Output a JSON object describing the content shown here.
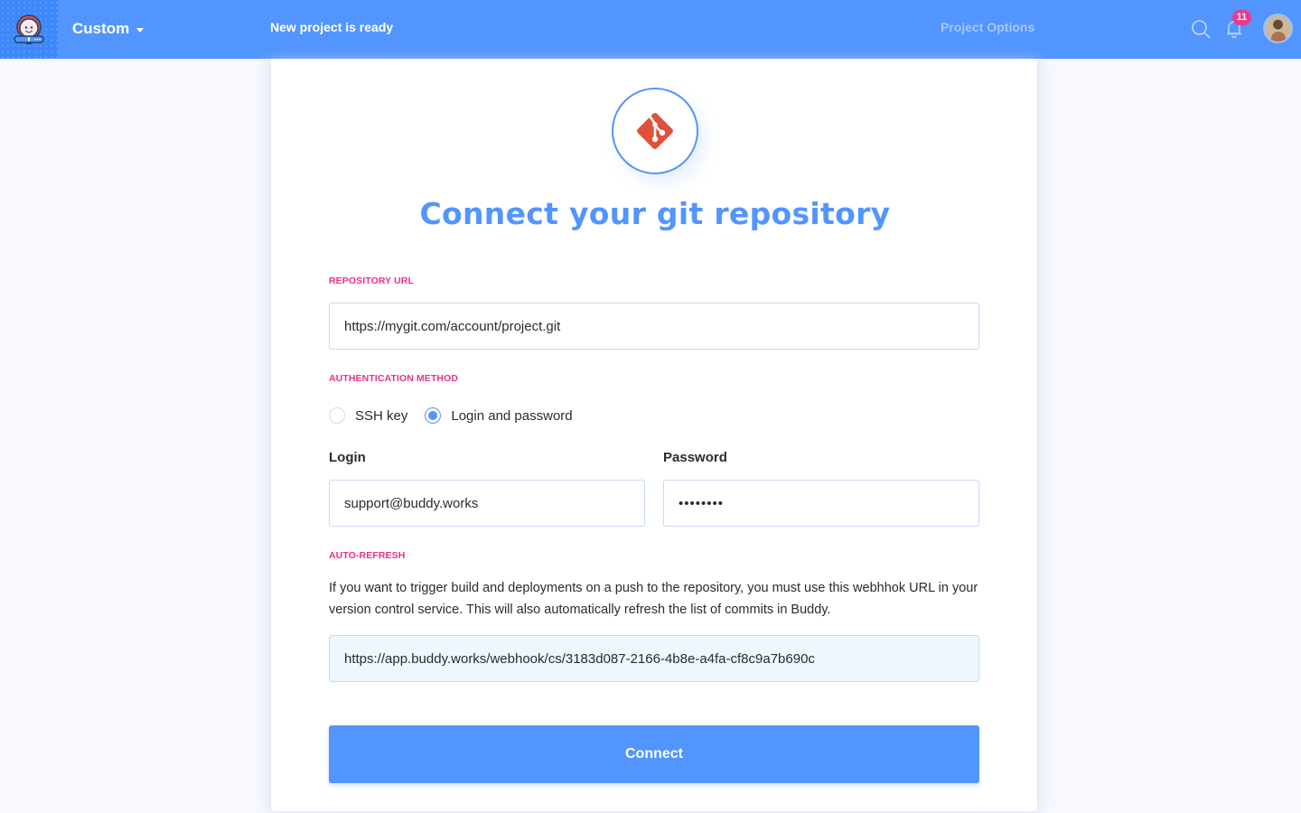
{
  "topbar": {
    "workspace": "Custom",
    "notice": "New project is ready",
    "project_options": "Project Options",
    "notification_count": "11",
    "icons": {
      "logo": "buddy-astronaut-logo",
      "search": "search-icon",
      "notifications": "bell-icon",
      "avatar": "user-avatar"
    }
  },
  "card": {
    "icon": "git-icon",
    "title": "Connect your git repository",
    "repository": {
      "label": "REPOSITORY URL",
      "value": "https://mygit.com/account/project.git"
    },
    "auth": {
      "label": "AUTHENTICATION METHOD",
      "options": [
        {
          "label": "SSH key",
          "checked": false
        },
        {
          "label": "Login and password",
          "checked": true
        }
      ]
    },
    "login": {
      "label": "Login",
      "value": "support@buddy.works"
    },
    "password": {
      "label": "Password",
      "value": "••••••••"
    },
    "auto_refresh": {
      "label": "AUTO-REFRESH",
      "help": "If you want to trigger build and deployments on a push to the repository, you must use this webhhok URL in your version control service. This will also automatically refresh the list of commits in Buddy.",
      "webhook_url": "https://app.buddy.works/webhook/cs/3183d087-2166-4b8e-a4fa-cf8c9a7b690c"
    },
    "connect_label": "Connect"
  },
  "colors": {
    "brand_blue": "#5295fe",
    "label_pink": "#e8328a",
    "git_orange": "#e0503a",
    "badge_pink": "#ea3a8c"
  }
}
